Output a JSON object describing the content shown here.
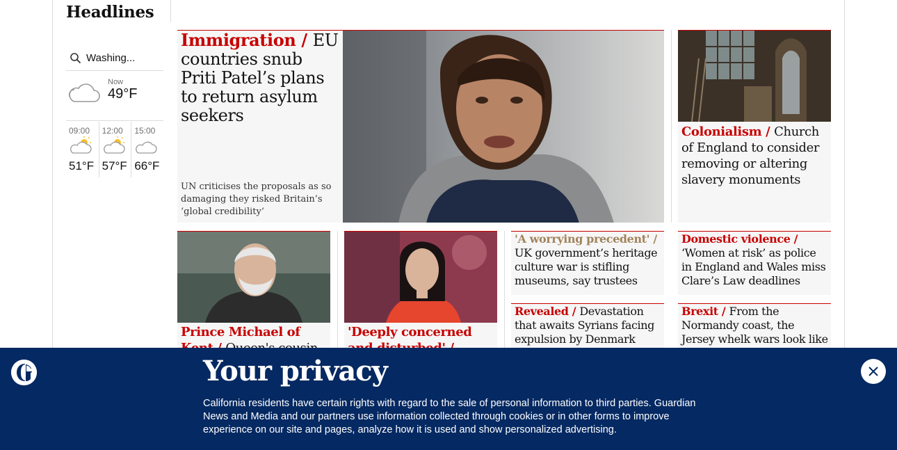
{
  "section": {
    "title": "Headlines"
  },
  "weather": {
    "location": "Washing...",
    "now_label": "Now",
    "now_temp": "49°F",
    "now_icon": "cloud-icon",
    "forecast": [
      {
        "time": "09:00",
        "temp": "51°F",
        "icon": "partly-sunny-icon"
      },
      {
        "time": "12:00",
        "temp": "57°F",
        "icon": "partly-sunny-icon"
      },
      {
        "time": "15:00",
        "temp": "66°F",
        "icon": "cloud-icon"
      }
    ]
  },
  "stories": {
    "main": {
      "kicker": "Immigration / ",
      "headline": "EU countries snub Priti Patel’s plans to return asylum seekers",
      "standfirst": "UN criticises the proposals as so damaging they risked Britain’s ‘global credibility’"
    },
    "church": {
      "kicker": "Colonialism / ",
      "headline": "Church of England to consider removing or altering slavery monuments"
    },
    "prince": {
      "kicker": "Prince Michael of Kent / ",
      "headline": "Queen's cousin"
    },
    "gemma": {
      "kicker": "'Deeply concerned and disturbed' / ",
      "headline": ""
    },
    "heritage": {
      "kicker": "'A worrying precedent' / ",
      "headline": "UK government’s heritage culture war is stifling museums, say trustees"
    },
    "domestic": {
      "kicker": "Domestic violence / ",
      "headline": "‘Women at risk’ as police in England and Wales miss Clare’s Law deadlines"
    },
    "syrians": {
      "kicker": "Revealed / ",
      "headline": "Devastation that awaits Syrians facing expulsion by Denmark"
    },
    "brexit": {
      "kicker": "Brexit / ",
      "headline": "From the Normandy coast, the Jersey whelk wars look like"
    }
  },
  "privacy": {
    "title": "Your privacy",
    "body": "California residents have certain rights with regard to the sale of personal information to third parties. Guardian News and Media and our partners use information collected through cookies or in other forms to improve experience on our site and pages, analyze how it is used and show personalized advertising."
  },
  "colors": {
    "brand_blue": "#052962",
    "news_red": "#c70000",
    "muted_kicker": "#a1845c"
  }
}
